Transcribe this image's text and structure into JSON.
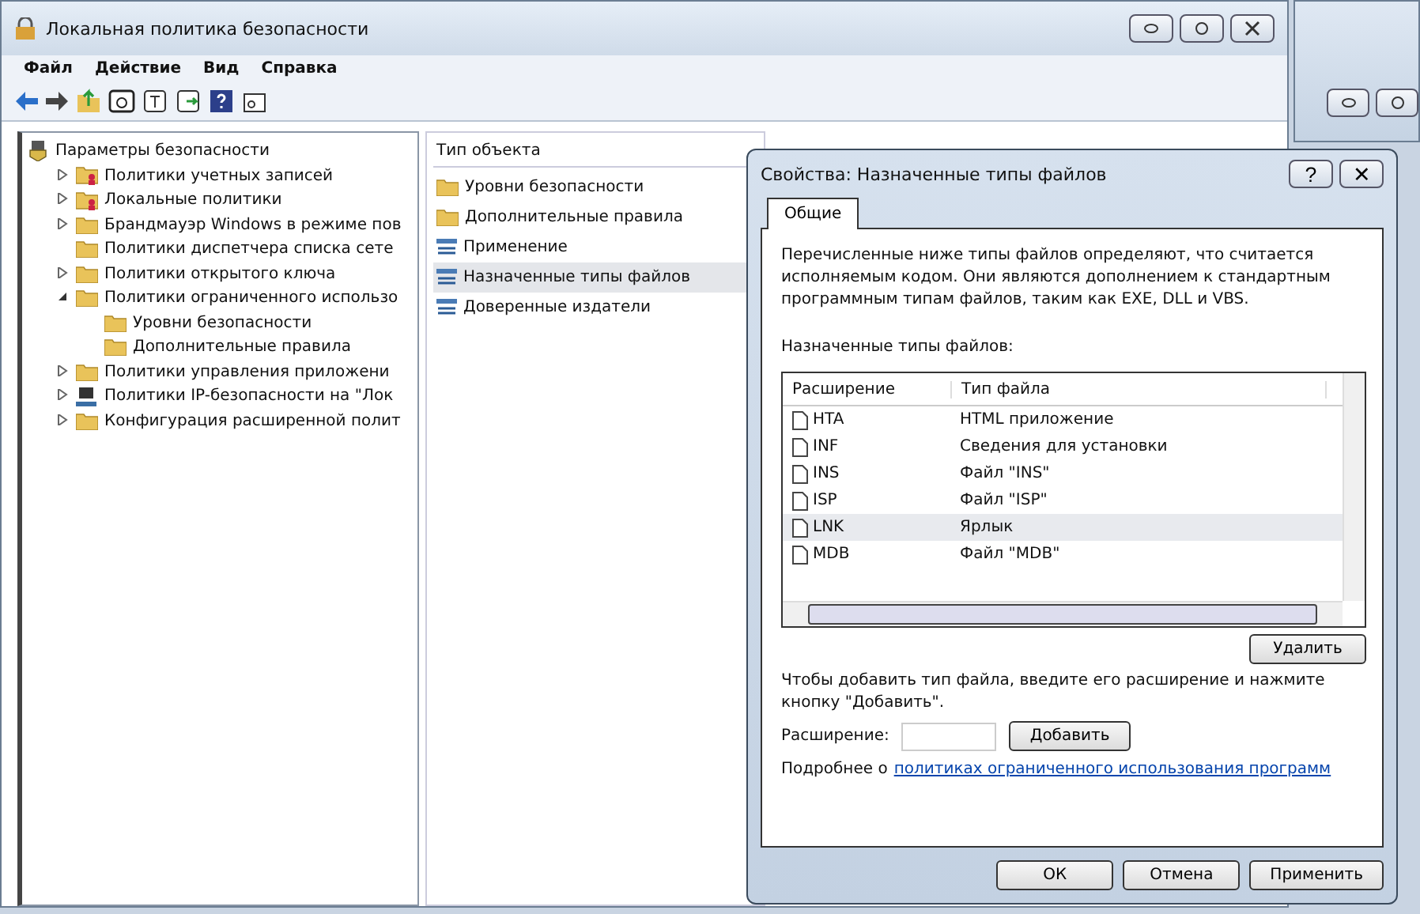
{
  "window": {
    "title": "Локальная политика безопасности"
  },
  "menu": [
    "Файл",
    "Действие",
    "Вид",
    "Справка"
  ],
  "tree": [
    {
      "label": "Параметры безопасности",
      "kind": "root",
      "children": [
        {
          "label": "Политики учетных записей",
          "kind": "policy",
          "expanded": false
        },
        {
          "label": "Локальные политики",
          "kind": "policy",
          "expanded": false
        },
        {
          "label": "Брандмауэр Windows в режиме пов",
          "kind": "folder",
          "expanded": false
        },
        {
          "label": "Политики диспетчера списка сете",
          "kind": "folder"
        },
        {
          "label": "Политики открытого ключа",
          "kind": "folder",
          "expanded": false
        },
        {
          "label": "Политики ограниченного использо",
          "kind": "folder",
          "expanded": true,
          "children": [
            {
              "label": "Уровни безопасности",
              "kind": "folder"
            },
            {
              "label": "Дополнительные правила",
              "kind": "folder"
            }
          ]
        },
        {
          "label": "Политики управления приложени",
          "kind": "folder",
          "expanded": false
        },
        {
          "label": "Политики IP-безопасности на \"Лок",
          "kind": "computer",
          "expanded": false
        },
        {
          "label": "Конфигурация расширенной полит",
          "kind": "folder",
          "expanded": false
        }
      ]
    }
  ],
  "list": {
    "header": "Тип объекта",
    "items": [
      {
        "label": "Уровни безопасности",
        "kind": "folder",
        "selected": false
      },
      {
        "label": "Дополнительные правила",
        "kind": "folder",
        "selected": false
      },
      {
        "label": "Применение",
        "kind": "object",
        "selected": false
      },
      {
        "label": "Назначенные типы файлов",
        "kind": "object",
        "selected": true
      },
      {
        "label": "Доверенные издатели",
        "kind": "object",
        "selected": false
      }
    ]
  },
  "dialog": {
    "title": "Свойства: Назначенные типы файлов",
    "help": "?",
    "close": "✕",
    "tabs": [
      {
        "label": "Общие",
        "selected": true
      }
    ],
    "description": "Перечисленные ниже типы файлов определяют, что считается исполняемым кодом. Они являются дополнением к стандартным программным типам файлов, таким как EXE, DLL и VBS.",
    "list_label": "Назначенные типы файлов:",
    "columns": [
      "Расширение",
      "Тип файла"
    ],
    "rows": [
      {
        "ext": "HTA",
        "type": "HTML приложение",
        "selected": false
      },
      {
        "ext": "INF",
        "type": "Сведения для установки",
        "selected": false
      },
      {
        "ext": "INS",
        "type": "Файл \"INS\"",
        "selected": false
      },
      {
        "ext": "ISP",
        "type": "Файл \"ISP\"",
        "selected": false
      },
      {
        "ext": "LNK",
        "type": "Ярлык",
        "selected": true
      },
      {
        "ext": "MDB",
        "type": "Файл \"MDB\"",
        "selected": false
      }
    ],
    "remove_button": "Удалить",
    "add_hint": "Чтобы добавить тип файла, введите его расширение и нажмите кнопку \"Добавить\".",
    "ext_label": "Расширение:",
    "add_button": "Добавить",
    "more_prefix": "Подробнее о",
    "more_link": "политиках ограниченного использования программ",
    "buttons": [
      "ОК",
      "Отмена",
      "Применить"
    ]
  }
}
